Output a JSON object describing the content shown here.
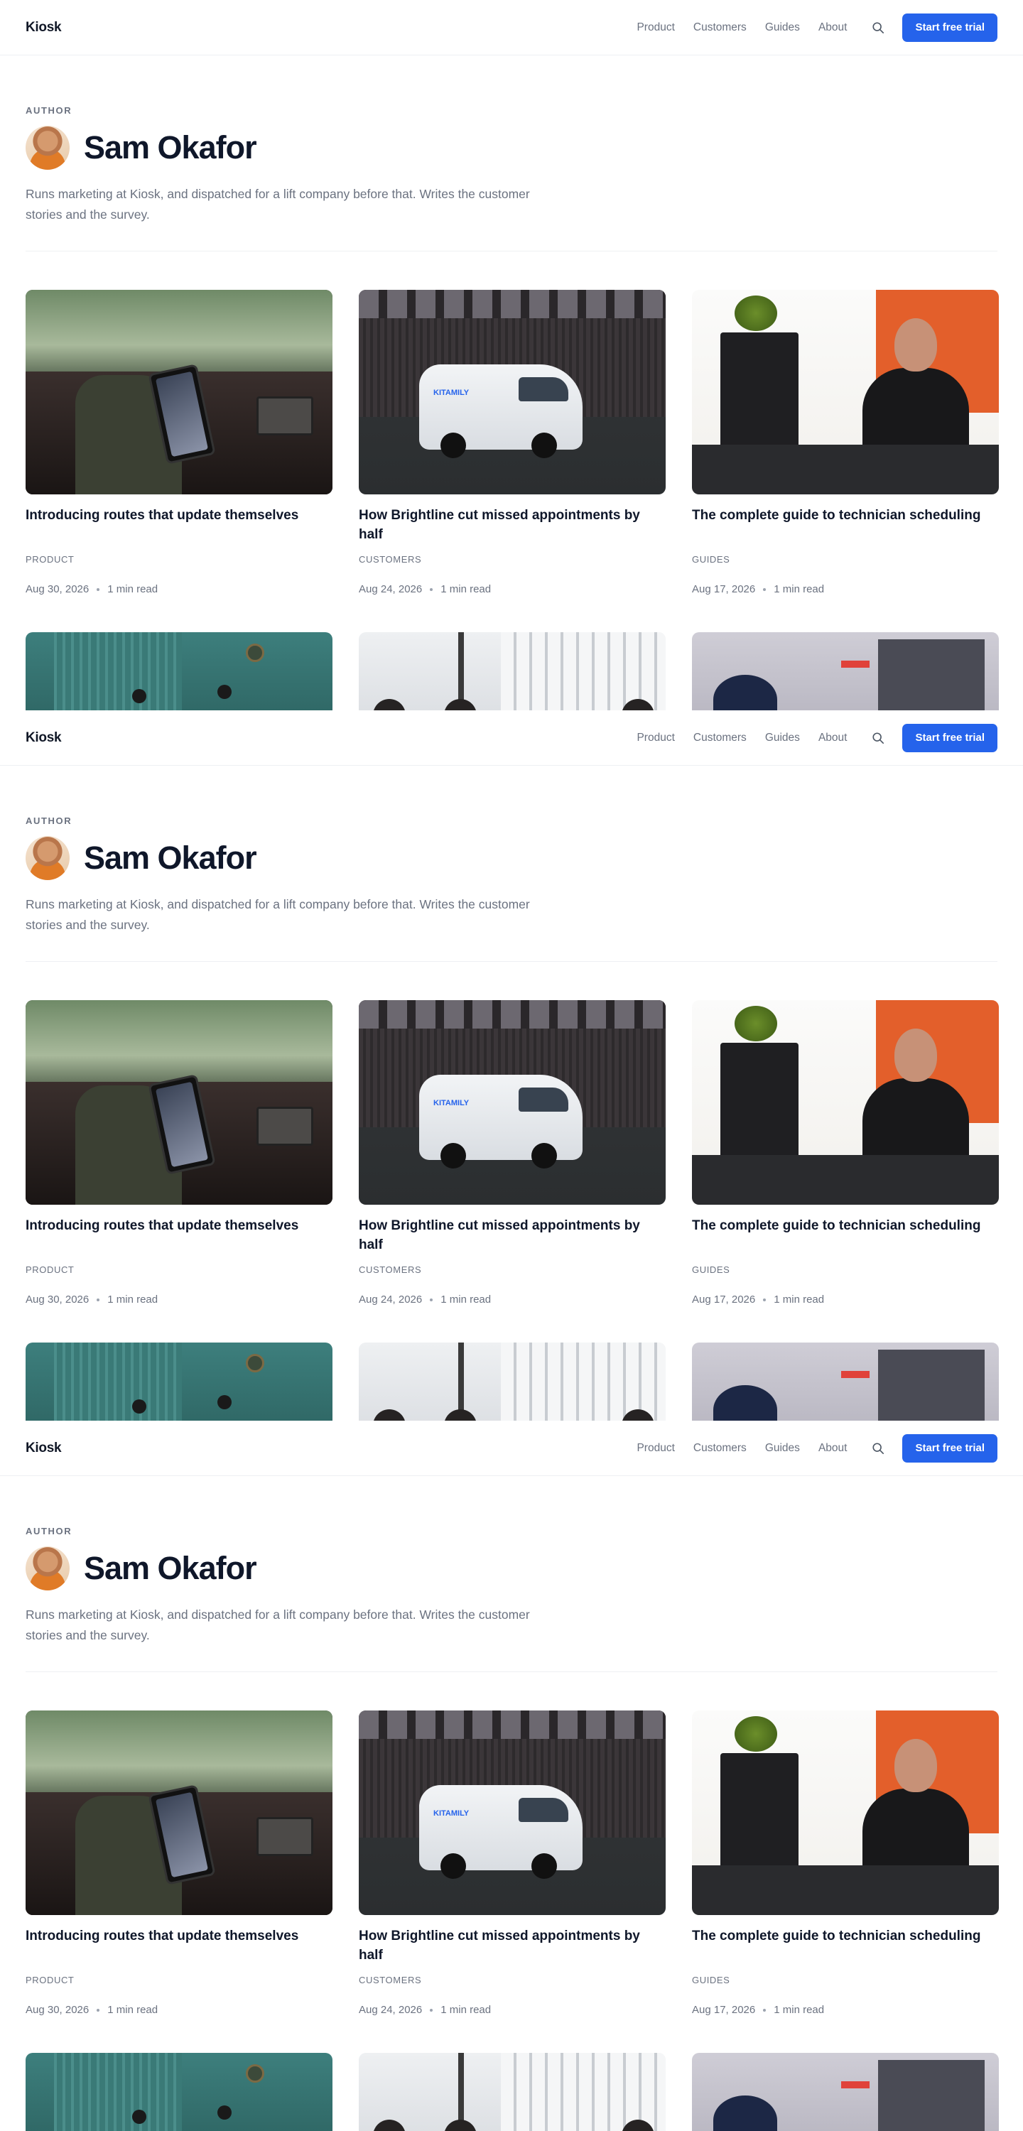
{
  "header": {
    "logo": "Kiosk",
    "nav": [
      "Product",
      "Customers",
      "Guides",
      "About"
    ],
    "search_icon": "search-icon",
    "cta": "Start free trial"
  },
  "author": {
    "eyebrow": "AUTHOR",
    "name": "Sam Okafor",
    "bio": "Runs marketing at Kiosk, and dispatched for a lift company before that. Writes the customer stories and the survey."
  },
  "posts": [
    {
      "title": "Introducing routes that update themselves",
      "category": "PRODUCT",
      "date": "Aug 30, 2026",
      "read": "1 min read"
    },
    {
      "title": "How Brightline cut missed appointments by half",
      "category": "CUSTOMERS",
      "date": "Aug 24, 2026",
      "read": "1 min read"
    },
    {
      "title": "The complete guide to technician scheduling",
      "category": "GUIDES",
      "date": "Aug 17, 2026",
      "read": "1 min read"
    }
  ],
  "van_logo": "KITAMILY",
  "colors": {
    "accent": "#2563eb",
    "text": "#0f172a",
    "muted": "#6b7280"
  }
}
